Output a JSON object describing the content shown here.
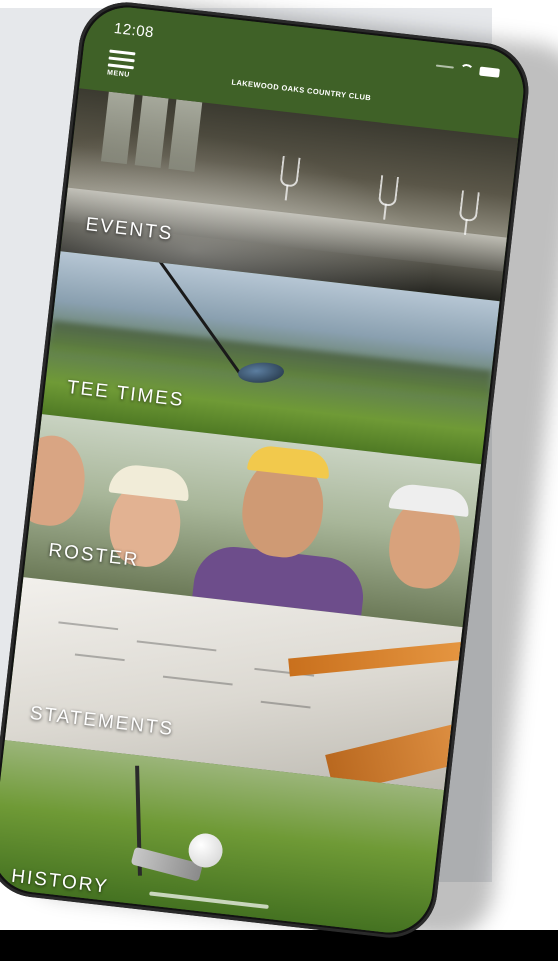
{
  "status_bar": {
    "time": "12:08"
  },
  "header": {
    "menu_label": "MENU",
    "club_name": "LAKEWOOD OAKS COUNTRY CLUB"
  },
  "tiles": [
    {
      "label": "EVENTS"
    },
    {
      "label": "TEE TIMES"
    },
    {
      "label": "ROSTER"
    },
    {
      "label": "STATEMENTS"
    },
    {
      "label": "HISTORY"
    }
  ],
  "colors": {
    "brand_green": "#3f6127",
    "backdrop": "#e6e8eb"
  },
  "icons": [
    "menu-icon",
    "wifi-icon",
    "battery-icon",
    "signal-icon"
  ]
}
